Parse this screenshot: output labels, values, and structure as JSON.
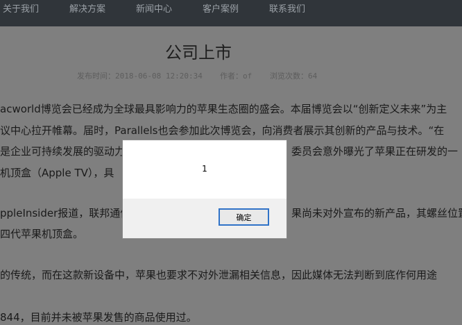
{
  "nav": {
    "items": [
      "关于我们",
      "解决方案",
      "新闻中心",
      "客户案例",
      "联系我们"
    ]
  },
  "article": {
    "title": "公司上市",
    "meta": {
      "publish_time": "发布时间：2018-06-08 12:20:34",
      "author": "作者：of",
      "views": "浏览次数：64"
    },
    "lines": [
      "acworld博览会已经成为全球最具影响力的苹果生态圈的盛会。本届博览会以“创新定义未来”为主",
      "议中心拉开帷幕。届时，Parallels也会参加此次博览会，向消费者展示其创新的产品与技术。“在",
      "是企业可持续发展的驱动力",
      "委员会意外曝光了苹果正在研发的一",
      "机顶盒（Apple TV），具",
      "ppleInsider报道，联邦通信",
      "果尚未对外宣布的新产品，其螺丝位置",
      "四代苹果机顶盒。",
      "的传统，而在这款新设备中，苹果也要求不对外泄漏相关信息，因此媒体无法判断到底作何用途",
      "844，目前并未被苹果发售的商品使用过。"
    ]
  },
  "dialog": {
    "message": "1",
    "ok_label": "确定"
  }
}
